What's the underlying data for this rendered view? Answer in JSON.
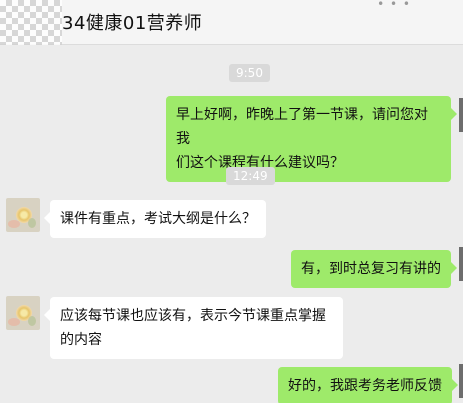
{
  "chat": {
    "title": "34健康01营养师",
    "more_icon": "more-icon"
  },
  "messages": [
    {
      "type": "time",
      "text": "9:50"
    },
    {
      "type": "outgoing",
      "lines": [
        "早上好啊，昨晚上了第一节课，请问您对我",
        "们这个课程有什么建议吗？"
      ]
    },
    {
      "type": "time",
      "text": "12:49"
    },
    {
      "type": "incoming",
      "lines": [
        "课件有重点，考试大纲是什么？"
      ]
    },
    {
      "type": "outgoing",
      "lines": [
        "有，到时总复习有讲的"
      ]
    },
    {
      "type": "incoming",
      "lines": [
        "应该每节课也应该有，表示今节课重点掌握",
        "的内容"
      ]
    },
    {
      "type": "outgoing",
      "lines": [
        "好的，我跟考务老师反馈"
      ]
    }
  ],
  "colors": {
    "outgoing_bubble": "#9eea6a",
    "incoming_bubble": "#ffffff",
    "background": "#ececec"
  }
}
